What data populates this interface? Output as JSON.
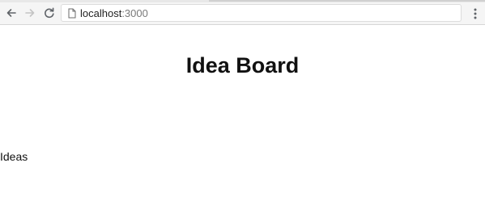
{
  "browser": {
    "url_host": "localhost",
    "url_port": ":3000",
    "icons": {
      "back": "arrow-left-icon",
      "forward": "arrow-right-icon",
      "reload": "reload-icon",
      "page": "page-icon",
      "menu": "kebab-menu-icon"
    }
  },
  "page": {
    "title": "Idea Board",
    "section_label": "Ideas"
  }
}
